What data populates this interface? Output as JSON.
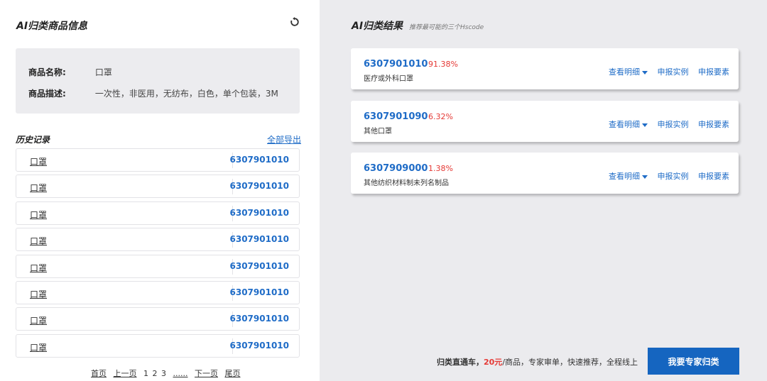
{
  "left": {
    "title": "AI归类商品信息",
    "refresh_icon": "refresh-icon",
    "product": {
      "name_label": "商品名称:",
      "name_value": "口罩",
      "desc_label": "商品描述:",
      "desc_value": "一次性，非医用，无纺布，白色，单个包装，3M"
    },
    "history": {
      "title": "历史记录",
      "export_label": "全部导出",
      "rows": [
        {
          "name": "口罩",
          "code": "6307901010"
        },
        {
          "name": "口罩",
          "code": "6307901010"
        },
        {
          "name": "口罩",
          "code": "6307901010"
        },
        {
          "name": "口罩",
          "code": "6307901010"
        },
        {
          "name": "口罩",
          "code": "6307901010"
        },
        {
          "name": "口罩",
          "code": "6307901010"
        },
        {
          "name": "口罩",
          "code": "6307901010"
        },
        {
          "name": "口罩",
          "code": "6307901010"
        }
      ]
    },
    "pager": {
      "first": "首页",
      "prev": "上一页",
      "p1": "1",
      "p2": "2",
      "p3": "3",
      "ellipsis": "......",
      "next": "下一页",
      "last": "尾页"
    }
  },
  "right": {
    "title": "AI归类结果",
    "subtitle": "推荐最可能的三个Hscode",
    "results": [
      {
        "code": "6307901010",
        "percent": "91.38%",
        "desc": "医疗或外科口罩",
        "detail": "查看明细",
        "example": "申报实例",
        "elements": "申报要素"
      },
      {
        "code": "6307901090",
        "percent": "6.32%",
        "desc": "其他口罩",
        "detail": "查看明细",
        "example": "申报实例",
        "elements": "申报要素"
      },
      {
        "code": "6307909000",
        "percent": "1.38%",
        "desc": "其他纺织材料制未列名制品",
        "detail": "查看明细",
        "example": "申报实例",
        "elements": "申报要素"
      }
    ],
    "promo": {
      "lead": "归类直通车，",
      "price": "20元",
      "rest": "/商品，专家审单，快速推荐，全程线上"
    },
    "expert_button": "我要专家归类"
  },
  "colors": {
    "accent": "#1f6cc7",
    "percent": "#e53935",
    "button": "#1565c0",
    "right_bg": "#ebebee",
    "info_bg": "#ececef"
  }
}
